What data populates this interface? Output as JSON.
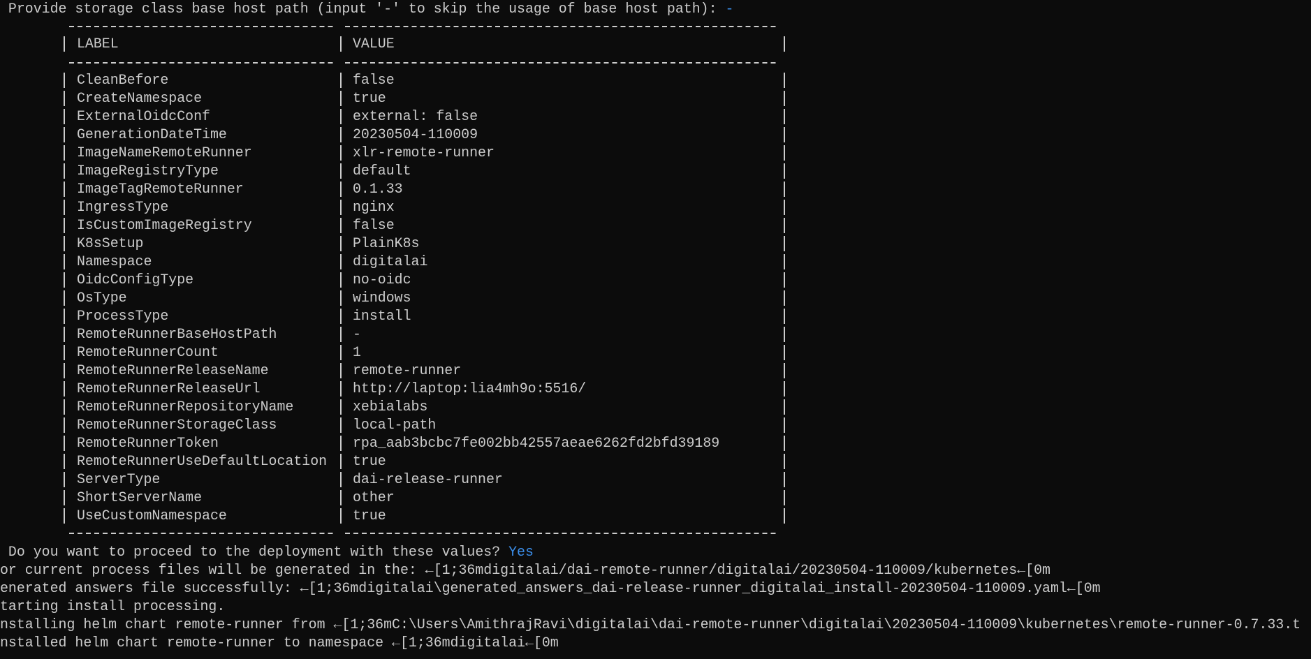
{
  "terminal": {
    "prompt_storage": {
      "question": " Provide storage class base host path (input '-' to skip the usage of base host path): ",
      "answer": "-"
    },
    "table": {
      "headers": [
        "LABEL",
        "VALUE"
      ],
      "rows": [
        {
          "label": "CleanBefore",
          "value": "false"
        },
        {
          "label": "CreateNamespace",
          "value": "true"
        },
        {
          "label": "ExternalOidcConf",
          "value": "external: false"
        },
        {
          "label": "GenerationDateTime",
          "value": "20230504-110009"
        },
        {
          "label": "ImageNameRemoteRunner",
          "value": "xlr-remote-runner"
        },
        {
          "label": "ImageRegistryType",
          "value": "default"
        },
        {
          "label": "ImageTagRemoteRunner",
          "value": "0.1.33"
        },
        {
          "label": "IngressType",
          "value": "nginx"
        },
        {
          "label": "IsCustomImageRegistry",
          "value": "false"
        },
        {
          "label": "K8sSetup",
          "value": "PlainK8s"
        },
        {
          "label": "Namespace",
          "value": "digitalai"
        },
        {
          "label": "OidcConfigType",
          "value": "no-oidc"
        },
        {
          "label": "OsType",
          "value": "windows"
        },
        {
          "label": "ProcessType",
          "value": "install"
        },
        {
          "label": "RemoteRunnerBaseHostPath",
          "value": "-"
        },
        {
          "label": "RemoteRunnerCount",
          "value": "1"
        },
        {
          "label": "RemoteRunnerReleaseName",
          "value": "remote-runner"
        },
        {
          "label": "RemoteRunnerReleaseUrl",
          "value": "http://laptop:lia4mh9o:5516/"
        },
        {
          "label": "RemoteRunnerRepositoryName",
          "value": "xebialabs"
        },
        {
          "label": "RemoteRunnerStorageClass",
          "value": "local-path"
        },
        {
          "label": "RemoteRunnerToken",
          "value": "rpa_aab3bcbc7fe002bb42557aeae6262fd2bfd39189"
        },
        {
          "label": "RemoteRunnerUseDefaultLocation",
          "value": "true"
        },
        {
          "label": "ServerType",
          "value": "dai-release-runner"
        },
        {
          "label": "ShortServerName",
          "value": "other"
        },
        {
          "label": "UseCustomNamespace",
          "value": "true"
        }
      ]
    },
    "prompt_proceed": {
      "question": " Do you want to proceed to the deployment with these values? ",
      "answer": "Yes"
    },
    "output_lines": [
      "or current process files will be generated in the: ←[1;36mdigitalai/dai-remote-runner/digitalai/20230504-110009/kubernetes←[0m",
      "enerated answers file successfully: ←[1;36mdigitalai\\generated_answers_dai-release-runner_digitalai_install-20230504-110009.yaml←[0m",
      "tarting install processing.",
      "nstalling helm chart remote-runner from ←[1;36mC:\\Users\\AmithrajRavi\\digitalai\\dai-remote-runner\\digitalai\\20230504-110009\\kubernetes\\remote-runner-0.7.33.t",
      "nstalled helm chart remote-runner to namespace ←[1;36mdigitalai←[0m"
    ],
    "colors": {
      "background": "#0c0c0c",
      "foreground": "#cccccc",
      "answer_blue": "#3b8eea"
    }
  }
}
